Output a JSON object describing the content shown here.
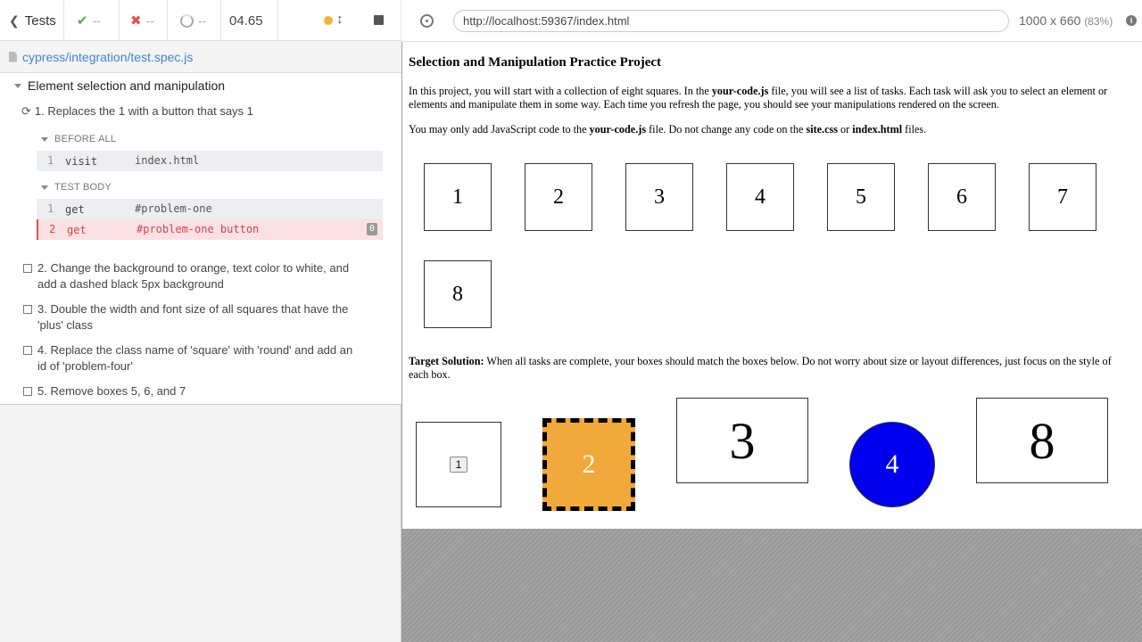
{
  "runner": {
    "back_label": "Tests",
    "passed": "--",
    "failed": "--",
    "pending": "--",
    "duration": "04.65",
    "spec_path": "cypress/integration/test.spec.js",
    "suite_title": "Element selection and manipulation",
    "active_test": "1. Replaces the 1 with a button that says 1",
    "hooks": {
      "before_all": "BEFORE ALL",
      "test_body": "TEST BODY"
    },
    "commands": [
      {
        "num": "1",
        "name": "visit",
        "message": "index.html"
      },
      {
        "num": "1",
        "name": "get",
        "message": "#problem-one"
      },
      {
        "num": "2",
        "name": "get",
        "message": "#problem-one button",
        "badge": "0"
      }
    ],
    "pending_tests": [
      "2. Change the background to orange, text color to white, and add a dashed black 5px background",
      "3. Double the width and font size of all squares that have the 'plus' class",
      "4. Replace the class name of 'square' with 'round' and add an id of 'problem-four'",
      "5. Remove boxes 5, 6, and 7"
    ],
    "colors": {
      "pass": "#4cae4c",
      "fail": "#e94f4f",
      "link": "#3b86d1",
      "running": "#f0b737"
    }
  },
  "aut": {
    "url": "http://localhost:59367/index.html",
    "viewport": "1000 x 660",
    "scale": "(83%)",
    "icons": [
      "crosshair-icon",
      "info-icon"
    ]
  },
  "page": {
    "title": "Selection and Manipulation Practice Project",
    "para1_a": "In this project, you will start with a collection of eight squares. In the ",
    "para1_b": "your-code.js",
    "para1_c": " file, you will see a list of tasks. Each task will ask you to select an element or elements and manipulate them in some way. Each time you refresh the page, you should see your manipulations rendered on the screen.",
    "para2_a": "You may only add JavaScript code to the ",
    "para2_b": "your-code.js",
    "para2_c": " file. Do not change any code on the ",
    "para2_d": "site.css",
    "para2_e": " or ",
    "para2_f": "index.html",
    "para2_g": " files.",
    "squares": [
      "1",
      "2",
      "3",
      "4",
      "5",
      "6",
      "7",
      "8"
    ],
    "para3_a": "Target Solution:",
    "para3_b": " When all tasks are complete, your boxes should match the boxes below. Do not worry about size or layout differences, just focus on the style of each box.",
    "targets": [
      "1",
      "2",
      "3",
      "4",
      "8"
    ],
    "target_colors": {
      "orange": "#f1a93b",
      "blue": "#0000ee"
    }
  }
}
